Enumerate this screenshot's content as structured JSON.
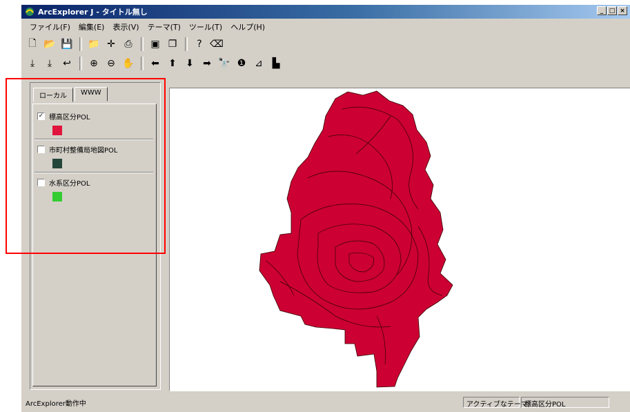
{
  "window": {
    "title": "ArcExplorer J - タイトル無し",
    "controls": [
      "_",
      "□",
      "×"
    ]
  },
  "menu": [
    "ファイル(F)",
    "編集(E)",
    "表示(V)",
    "テーマ(T)",
    "ツール(T)",
    "ヘルプ(H)"
  ],
  "toolbar1": [
    {
      "icon": "new-icon",
      "glyph": "🗋"
    },
    {
      "icon": "open-icon",
      "glyph": "📂"
    },
    {
      "icon": "save-icon",
      "glyph": "💾"
    },
    {
      "icon": "open-project-icon",
      "glyph": "📁"
    },
    {
      "icon": "add-theme-icon",
      "glyph": "✛"
    },
    {
      "icon": "print-icon",
      "glyph": "⎙"
    },
    {
      "icon": "layout-icon",
      "glyph": "▣"
    },
    {
      "icon": "copy-icon",
      "glyph": "❐"
    },
    {
      "icon": "query-icon",
      "glyph": "?"
    },
    {
      "icon": "eraser-icon",
      "glyph": "⌫"
    }
  ],
  "toolbar2": [
    {
      "icon": "full-extent-icon",
      "glyph": "⤓"
    },
    {
      "icon": "zoom-active-icon",
      "glyph": "⤓"
    },
    {
      "icon": "zoom-previous-icon",
      "glyph": "↩"
    },
    {
      "icon": "zoom-in-icon",
      "glyph": "⊕"
    },
    {
      "icon": "zoom-out-icon",
      "glyph": "⊖"
    },
    {
      "icon": "pan-icon",
      "glyph": "✋"
    },
    {
      "icon": "pan-west-icon",
      "glyph": "⬅"
    },
    {
      "icon": "pan-north-icon",
      "glyph": "⬆"
    },
    {
      "icon": "pan-south-icon",
      "glyph": "⬇"
    },
    {
      "icon": "pan-east-icon",
      "glyph": "➡"
    },
    {
      "icon": "find-icon",
      "glyph": "🔭"
    },
    {
      "icon": "identify-icon",
      "glyph": "❶"
    },
    {
      "icon": "measure-icon",
      "glyph": "⊿"
    },
    {
      "icon": "query-builder-icon",
      "glyph": "▙"
    }
  ],
  "legend": {
    "tabs": [
      "ローカル",
      "WWW"
    ],
    "themes": [
      {
        "name": "標高区分POL",
        "checked": true,
        "color": "#e0143c"
      },
      {
        "name": "市町村整備局地図POL",
        "checked": false,
        "color": "#24453a"
      },
      {
        "name": "水系区分POL",
        "checked": false,
        "color": "#33cc33"
      }
    ]
  },
  "map": {
    "fill_color": "#cc0033",
    "background": "#ffffff"
  },
  "status": {
    "left": "ArcExplorer動作中",
    "active_theme_label": "アクティブなテーマ:",
    "active_theme_value": "標高区分POL"
  },
  "highlight_color": "#ff0000"
}
